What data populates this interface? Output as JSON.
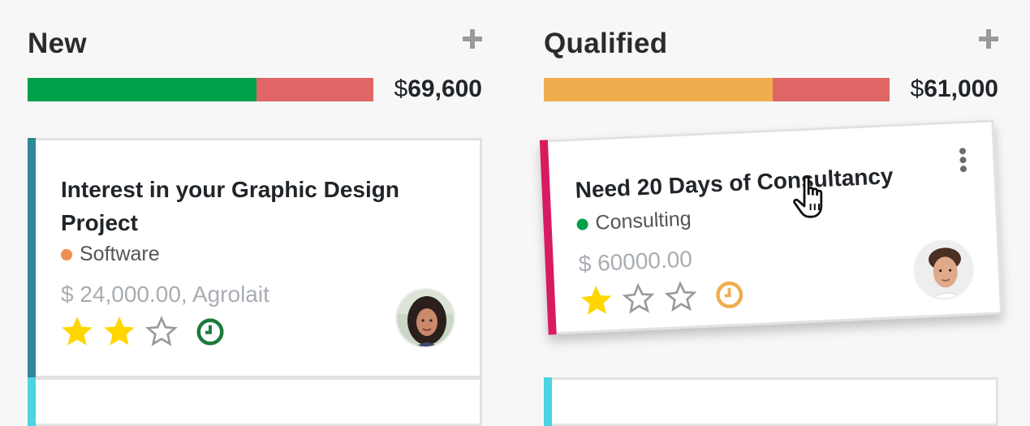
{
  "columns": [
    {
      "title": "New",
      "total_currency": "$",
      "total_amount": "69,600",
      "progress": [
        {
          "color": "#00a04a",
          "fraction": 0.662
        },
        {
          "color": "#e06666",
          "fraction": 0.338
        }
      ],
      "cards": [
        {
          "title": "Interest in your Graphic Design Project",
          "tag": "Software",
          "tag_color": "#ef8f4f",
          "amount": "$ 24,000.00, Agrolait",
          "accent": "#2e8897",
          "stars_filled": 2,
          "stars_total": 3,
          "activity_color": "#1b7a3a",
          "avatar": "woman-avatar"
        }
      ],
      "next_card_accent": "#4cd4e0"
    },
    {
      "title": "Qualified",
      "total_currency": "$",
      "total_amount": "61,000",
      "progress": [
        {
          "color": "#f0ad4e",
          "fraction": 0.662
        },
        {
          "color": "#e06666",
          "fraction": 0.338
        }
      ],
      "cards": [
        {
          "title": "Need 20 Days of Consultancy",
          "tag": "Consulting",
          "tag_color": "#00a04a",
          "amount": "$ 60000.00",
          "accent": "#d81b60",
          "stars_filled": 1,
          "stars_total": 3,
          "activity_color": "#f0ad4e",
          "avatar": "man-avatar"
        }
      ],
      "next_card_accent": "#4cd4e0"
    }
  ],
  "icons": {
    "add": "plus-icon",
    "star": "star-icon",
    "clock": "clock-icon",
    "menu": "kebab-menu-icon",
    "cursor": "hand-pointer-cursor-icon"
  }
}
